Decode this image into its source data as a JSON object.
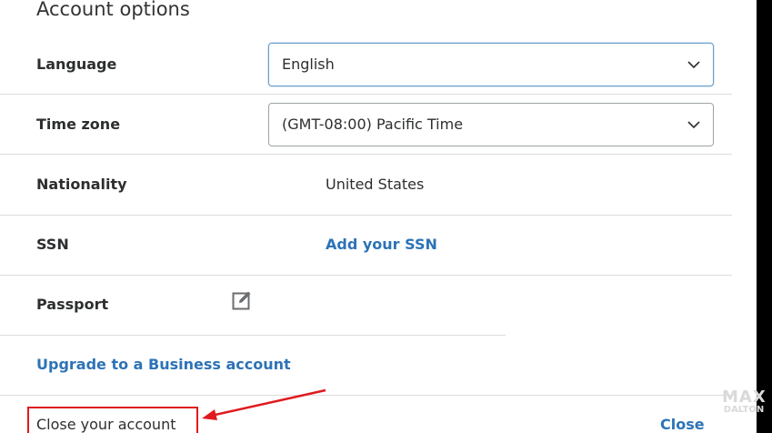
{
  "dialog": {
    "title": "Account options",
    "rows": {
      "language": {
        "label": "Language",
        "value": "English"
      },
      "timezone": {
        "label": "Time zone",
        "value": "(GMT-08:00) Pacific Time"
      },
      "nationality": {
        "label": "Nationality",
        "value": "United States"
      },
      "ssn": {
        "label": "SSN",
        "link": "Add your SSN"
      },
      "passport": {
        "label": "Passport",
        "icon": "edit-icon"
      }
    },
    "upgrade_link": "Upgrade to a Business account",
    "close_account": "Close your account",
    "close_button": "Close"
  },
  "annotation": {
    "color": "#e0191f"
  },
  "watermark": {
    "line1": "MAX",
    "line2": "DALTON"
  },
  "colors": {
    "link": "#2d73b6",
    "text": "#2c2e2f",
    "background": "#000000"
  }
}
